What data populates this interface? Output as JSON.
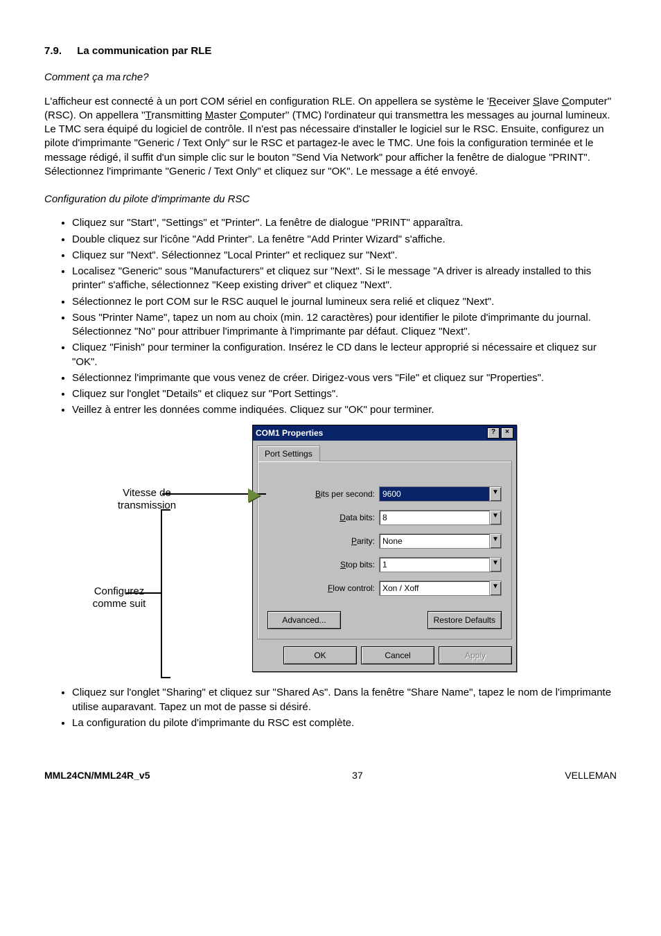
{
  "section": {
    "number": "7.9.",
    "title": "La communication par RLE"
  },
  "sub1": "Comment ça ma rche?",
  "para_parts": {
    "a": "L'afficheur est connecté à un port COM sériel en configuration RLE. On appellera se système le '",
    "r": "R",
    "b": "eceiver ",
    "s": "S",
    "c": "lave ",
    "co": "C",
    "d": "omputer'' (RSC). On appellera ''",
    "t": "T",
    "e": "ransmitting ",
    "m": "M",
    "f": "aster ",
    "co2": "C",
    "g": "omputer'' (TMC) l'ordinateur qui transmettra les messages au journal lumineux. Le TMC sera équipé du logiciel de contrôle. Il n'est pas nécessaire d'installer le logiciel sur le RSC. Ensuite, configurez un pilote d'imprimante \"Generic / Text Only\" sur le RSC et partagez-le avec le TMC. Une fois la configuration terminée et le message rédigé, il suffit d'un simple clic sur le bouton \"Send Via Network\" pour afficher la fenêtre de dialogue \"PRINT\". Sélectionnez l'imprimante \"Generic / Text Only\" et cliquez sur \"OK\". Le message a été envoyé."
  },
  "sub2": "Configuration du pilote d'imprimante du RSC",
  "bullets1": [
    "Cliquez sur \"Start\", \"Settings\" et \"Printer\". La fenêtre de dialogue \"PRINT\" apparaîtra.",
    "Double cliquez sur l'icône \"Add Printer\". La fenêtre \"Add Printer Wizard\" s'affiche.",
    "Cliquez sur \"Next\". Sélectionnez \"Local Printer\" et recliquez sur \"Next\".",
    "Localisez \"Generic\" sous \"Manufacturers\" et cliquez sur \"Next\". Si le message \"A driver is already installed to this printer\" s'affiche, sélectionnez \"Keep existing driver\" et cliquez \"Next\".",
    "Sélectionnez le port COM sur le RSC auquel le journal lumineux sera relié et cliquez \"Next\".",
    "Sous \"Printer Name\", tapez un nom au choix (min. 12 caractères) pour identifier le pilote d'imprimante du journal. Sélectionnez \"No\" pour attribuer l'imprimante à l'imprimante par défaut. Cliquez \"Next\".",
    "Cliquez \"Finish\" pour terminer la configuration. Insérez le CD dans le lecteur approprié si nécessaire et cliquez sur \"OK\".",
    "Sélectionnez l'imprimante que vous venez de créer. Dirigez-vous vers \"File\" et cliquez sur \"Properties\".",
    "Cliquez sur l'onglet \"Details\" et cliquez sur \"Port Settings\".",
    "Veillez à entrer les données comme indiquées. Cliquez sur \"OK\" pour terminer."
  ],
  "callouts": {
    "c1_l1": "Vitesse de",
    "c1_l2": "transmission",
    "c2_l1": "Configurez",
    "c2_l2": "comme suit"
  },
  "dialog": {
    "title": "COM1 Properties",
    "help": "?",
    "close": "×",
    "tab": "Port Settings",
    "rows": [
      {
        "label_pre": "B",
        "label": "its per second:",
        "value": "9600",
        "selected": true
      },
      {
        "label_pre": "D",
        "label": "ata bits:",
        "value": "8",
        "selected": false
      },
      {
        "label_pre": "P",
        "label": "arity:",
        "value": "None",
        "selected": false
      },
      {
        "label_pre": "S",
        "label": "top bits:",
        "value": "1",
        "selected": false
      },
      {
        "label_pre": "F",
        "label": "low control:",
        "value": "Xon / Xoff",
        "selected": false
      }
    ],
    "advanced_pre": "A",
    "advanced": "dvanced...",
    "restore_pre": "R",
    "restore": "estore Defaults",
    "ok": "OK",
    "cancel": "Cancel",
    "apply_pre": "A",
    "apply": "pply"
  },
  "bullets2": [
    "Cliquez sur l'onglet \"Sharing\" et cliquez sur \"Shared As\". Dans la fenêtre \"Share Name\", tapez le nom de l'imprimante utilise auparavant. Tapez un mot de passe si désiré.",
    "La configuration du pilote d'imprimante du RSC est complète."
  ],
  "footer": {
    "left": "MML24CN/MML24R_v5",
    "center": "37",
    "right": "VELLEMAN"
  }
}
